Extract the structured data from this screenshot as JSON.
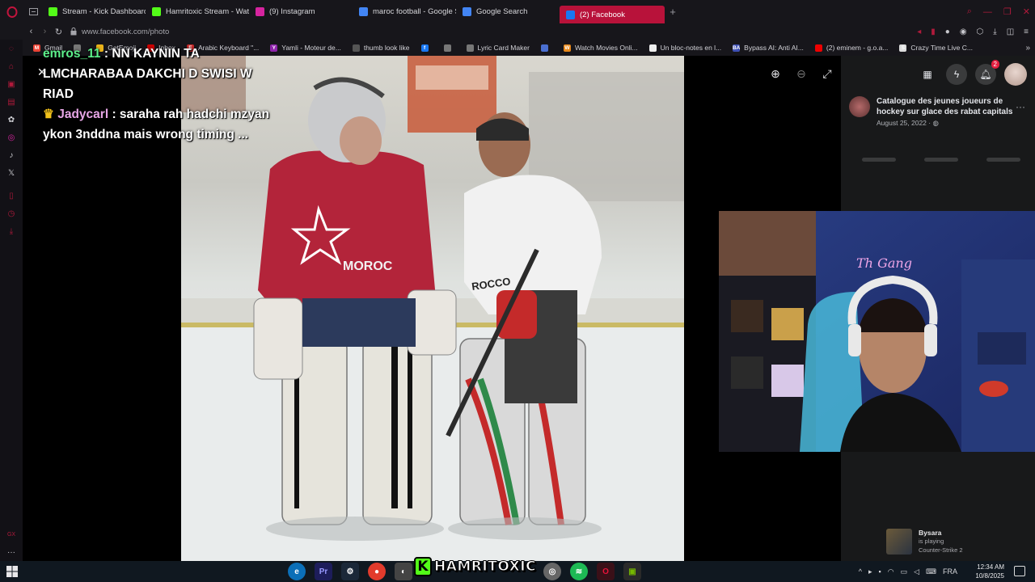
{
  "browser": {
    "tabs": [
      {
        "label": "Stream - Kick Dashboard",
        "icon": "kick-icon",
        "color": "#53fc18"
      },
      {
        "label": "Hamritoxic Stream - Watc",
        "icon": "kick-icon",
        "color": "#53fc18"
      },
      {
        "label": "(9) Instagram",
        "icon": "instagram-icon",
        "color": "#d6249f"
      },
      {
        "label": "maroc football - Google S",
        "icon": "google-icon",
        "color": "#4285f4"
      },
      {
        "label": "Google Search",
        "icon": "google-icon",
        "color": "#4285f4"
      },
      {
        "label": "(2) Facebook",
        "icon": "facebook-icon",
        "color": "#1877f2",
        "active": true
      }
    ],
    "url": "www.facebook.com/photo",
    "bookmarks": [
      {
        "label": "Gmail",
        "color": "#ea4335",
        "glyph": "M"
      },
      {
        "label": "",
        "color": "#777",
        "glyph": ""
      },
      {
        "label": "GetEmoji",
        "color": "#e8b21a",
        "glyph": ""
      },
      {
        "label": "Inbox",
        "color": "#c00",
        "glyph": ""
      },
      {
        "label": "Arabic Keyboard \"...",
        "color": "#c62828",
        "glyph": "E"
      },
      {
        "label": "Yamli - Moteur de...",
        "color": "#8e24aa",
        "glyph": "Y"
      },
      {
        "label": "thumb look like",
        "color": "#555",
        "glyph": ""
      },
      {
        "label": "",
        "color": "#1877f2",
        "glyph": "f"
      },
      {
        "label": "",
        "color": "#777",
        "glyph": ""
      },
      {
        "label": "Lyric Card Maker",
        "color": "#777",
        "glyph": ""
      },
      {
        "label": "",
        "color": "#4a6fd1",
        "glyph": ""
      },
      {
        "label": "Watch Movies Onli...",
        "color": "#e8881a",
        "glyph": "W"
      },
      {
        "label": "Un bloc-notes en l...",
        "color": "#eee",
        "glyph": ""
      },
      {
        "label": "Bypass AI: Anti AI...",
        "color": "#3f51b5",
        "glyph": "BA"
      },
      {
        "label": "(2) eminem - g.o.a...",
        "color": "#e00",
        "glyph": ""
      },
      {
        "label": "Crazy Time Live C...",
        "color": "#ddd",
        "glyph": "S"
      }
    ]
  },
  "chat": [
    {
      "user": "emros_11",
      "sep": " : ",
      "text": "NN KAYNIN TA LMCHARABAA DAKCHI D SWISI W RIAD",
      "color": "#5cf08a"
    },
    {
      "user": "Jadycarl",
      "sep": " : ",
      "text": "saraha rah hadchi mzyan ykon 3nddna mais wrong timing ...",
      "color": "#e7a6e6",
      "badge": "crown-icon"
    }
  ],
  "facebook": {
    "notification_count": "2",
    "post_title": "Catalogue des jeunes joueurs de hockey sur glace des rabat capitals",
    "post_date": "August 25, 2022 ·"
  },
  "activity": {
    "name": "Bysara",
    "line1": "is playing",
    "line2": "Counter-Strike 2"
  },
  "taskbar": {
    "brand": "HAMRITOXIC",
    "language": "FRA",
    "time": "12:34 AM",
    "date": "10/8/2025"
  },
  "colors": {
    "accent": "#b8123a",
    "kick_green": "#53fc18",
    "fb_panel": "#18191a"
  }
}
